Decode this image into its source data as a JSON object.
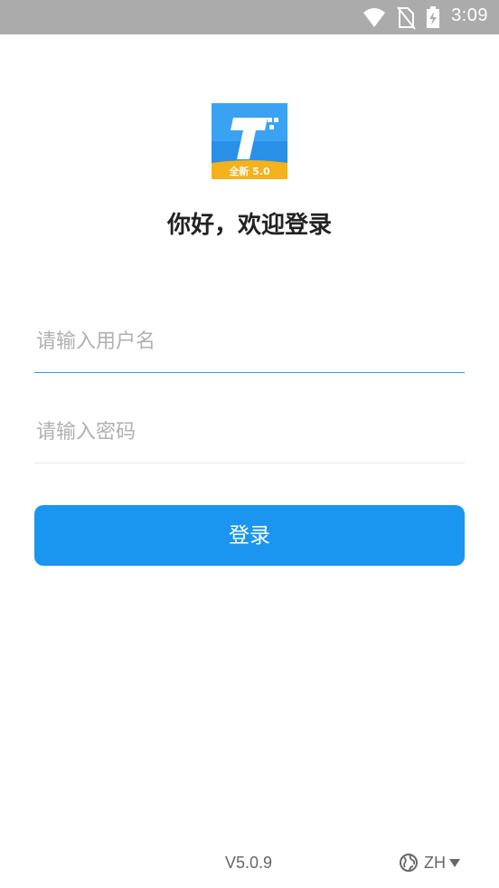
{
  "status_bar": {
    "time": "3:09",
    "icons": [
      "wifi-icon",
      "no-sim-icon",
      "battery-charging-icon"
    ]
  },
  "app": {
    "logo_text": "全新 5.0",
    "logo_icon": "app-logo-t",
    "greeting": "你好，欢迎登录"
  },
  "form": {
    "username_placeholder": "请输入用户名",
    "username_value": "",
    "password_placeholder": "请输入密码",
    "password_value": "",
    "login_label": "登录"
  },
  "footer": {
    "version": "V5.0.9",
    "language": "ZH",
    "language_icon": "globe-icon",
    "dropdown_icon": "triangle-down-icon"
  },
  "colors": {
    "status_bar": "#ababab",
    "accent": "#1a96f0",
    "active_underline": "#2f9cf0",
    "placeholder": "#b0b0b0",
    "logo_bg": "#2a8fe6",
    "logo_band": "#f5b21c"
  }
}
